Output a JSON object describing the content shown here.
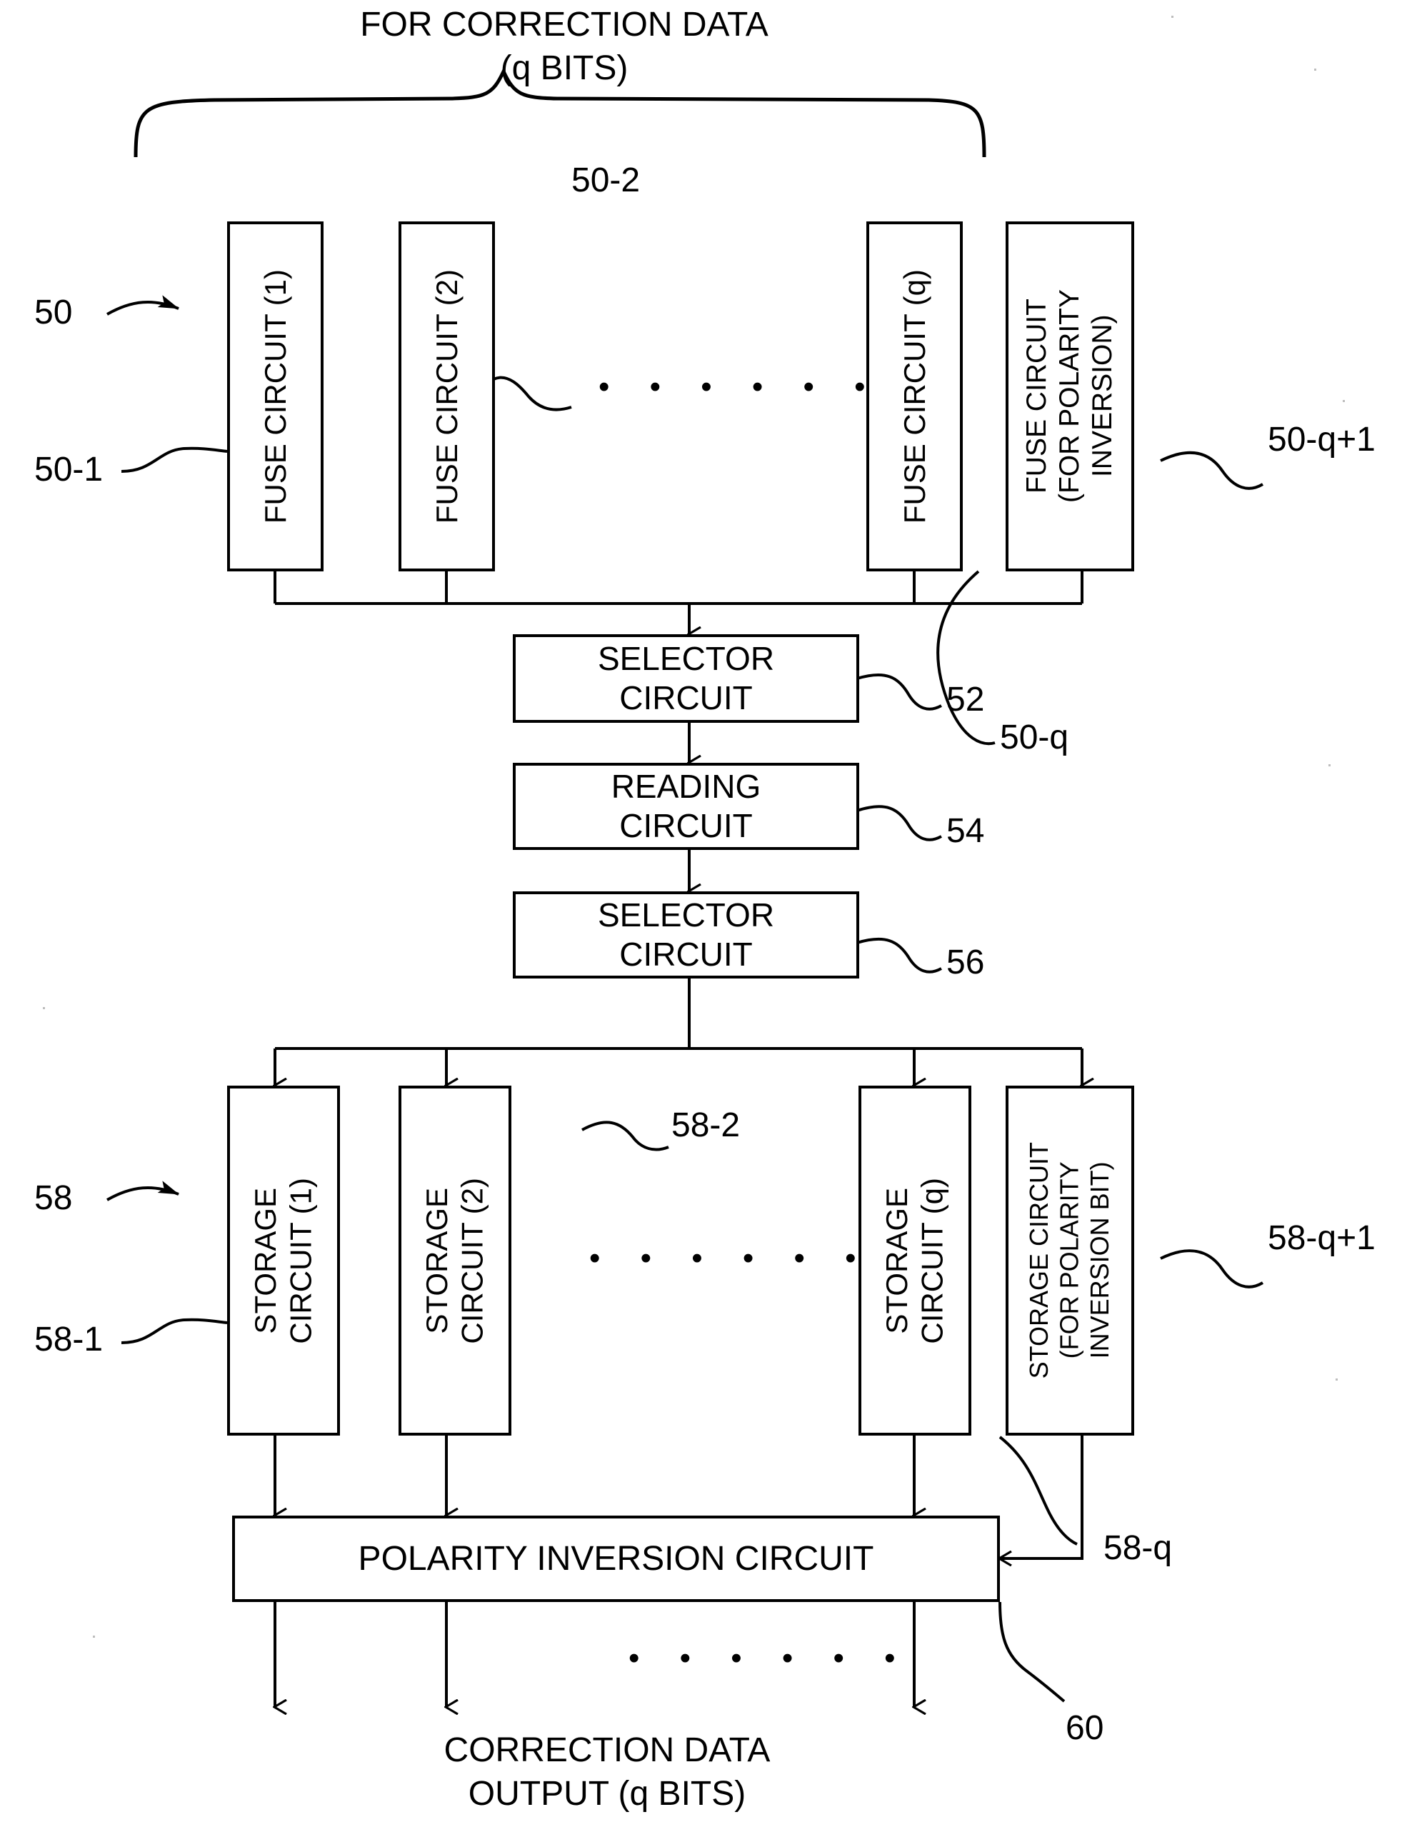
{
  "figure": {
    "top_caption": "FOR CORRECTION DATA\n(q BITS)",
    "bottom_caption": "CORRECTION DATA\nOUTPUT (q BITS)",
    "ellipsis": "• • • • • •"
  },
  "fuse_row": {
    "group_ref": "50",
    "boxes": [
      {
        "label": "FUSE CIRCUIT (1)",
        "ref": "50-1"
      },
      {
        "label": "FUSE CIRCUIT (2)",
        "ref": "50-2"
      },
      {
        "label": "FUSE CIRCUIT (q)",
        "ref": "50-q"
      },
      {
        "label": "FUSE CIRCUIT\n(FOR POLARITY\nINVERSION)",
        "ref": "50-q+1"
      }
    ]
  },
  "mid_chain": [
    {
      "label": "SELECTOR\nCIRCUIT",
      "ref": "52"
    },
    {
      "label": "READING\nCIRCUIT",
      "ref": "54"
    },
    {
      "label": "SELECTOR\nCIRCUIT",
      "ref": "56"
    }
  ],
  "storage_row": {
    "group_ref": "58",
    "boxes": [
      {
        "label": "STORAGE\nCIRCUIT (1)",
        "ref": "58-1"
      },
      {
        "label": "STORAGE\nCIRCUIT (2)",
        "ref": "58-2"
      },
      {
        "label": "STORAGE\nCIRCUIT (q)",
        "ref": "58-q"
      },
      {
        "label": "STORAGE CIRCUIT\n(FOR POLARITY\nINVERSION BIT)",
        "ref": "58-q+1"
      }
    ]
  },
  "output_stage": {
    "label": "POLARITY INVERSION CIRCUIT",
    "ref": "60"
  },
  "colors": {
    "ink": "#000000",
    "paper": "#ffffff"
  }
}
